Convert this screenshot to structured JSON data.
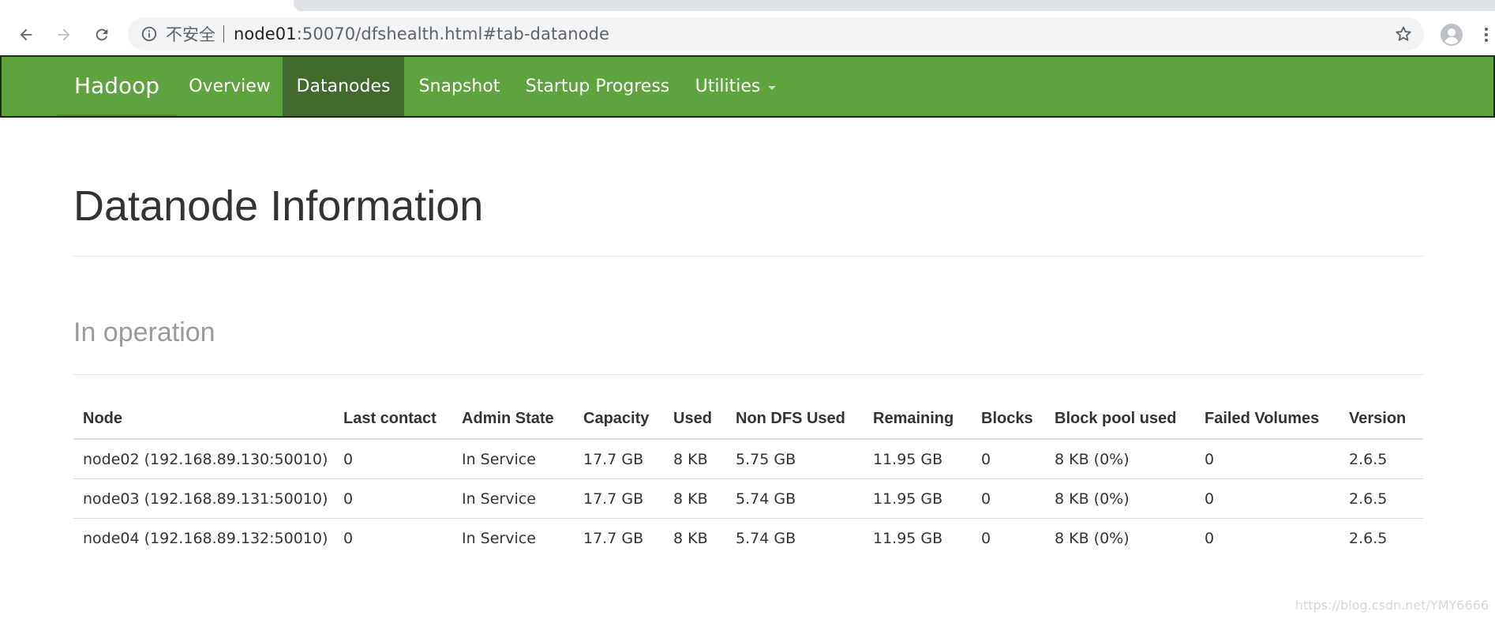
{
  "browser": {
    "security_label": "不安全",
    "url_host": "node01",
    "url_rest": ":50070/dfshealth.html#tab-datanode"
  },
  "navbar": {
    "brand": "Hadoop",
    "items": [
      {
        "label": "Overview",
        "active": false
      },
      {
        "label": "Datanodes",
        "active": true
      },
      {
        "label": "Snapshot",
        "active": false
      },
      {
        "label": "Startup Progress",
        "active": false
      },
      {
        "label": "Utilities",
        "active": false,
        "dropdown": true
      }
    ],
    "color": "#5fa33e",
    "active_color": "#3f6b2d"
  },
  "main": {
    "title": "Datanode Information",
    "section": "In operation",
    "table": {
      "columns": [
        "Node",
        "Last contact",
        "Admin State",
        "Capacity",
        "Used",
        "Non DFS Used",
        "Remaining",
        "Blocks",
        "Block pool used",
        "Failed Volumes",
        "Version"
      ],
      "rows": [
        [
          "node02 (192.168.89.130:50010)",
          "0",
          "In Service",
          "17.7 GB",
          "8 KB",
          "5.75 GB",
          "11.95 GB",
          "0",
          "8 KB (0%)",
          "0",
          "2.6.5"
        ],
        [
          "node03 (192.168.89.131:50010)",
          "0",
          "In Service",
          "17.7 GB",
          "8 KB",
          "5.74 GB",
          "11.95 GB",
          "0",
          "8 KB (0%)",
          "0",
          "2.6.5"
        ],
        [
          "node04 (192.168.89.132:50010)",
          "0",
          "In Service",
          "17.7 GB",
          "8 KB",
          "5.74 GB",
          "11.95 GB",
          "0",
          "8 KB (0%)",
          "0",
          "2.6.5"
        ]
      ]
    }
  },
  "watermark": "https://blog.csdn.net/YMY6666"
}
